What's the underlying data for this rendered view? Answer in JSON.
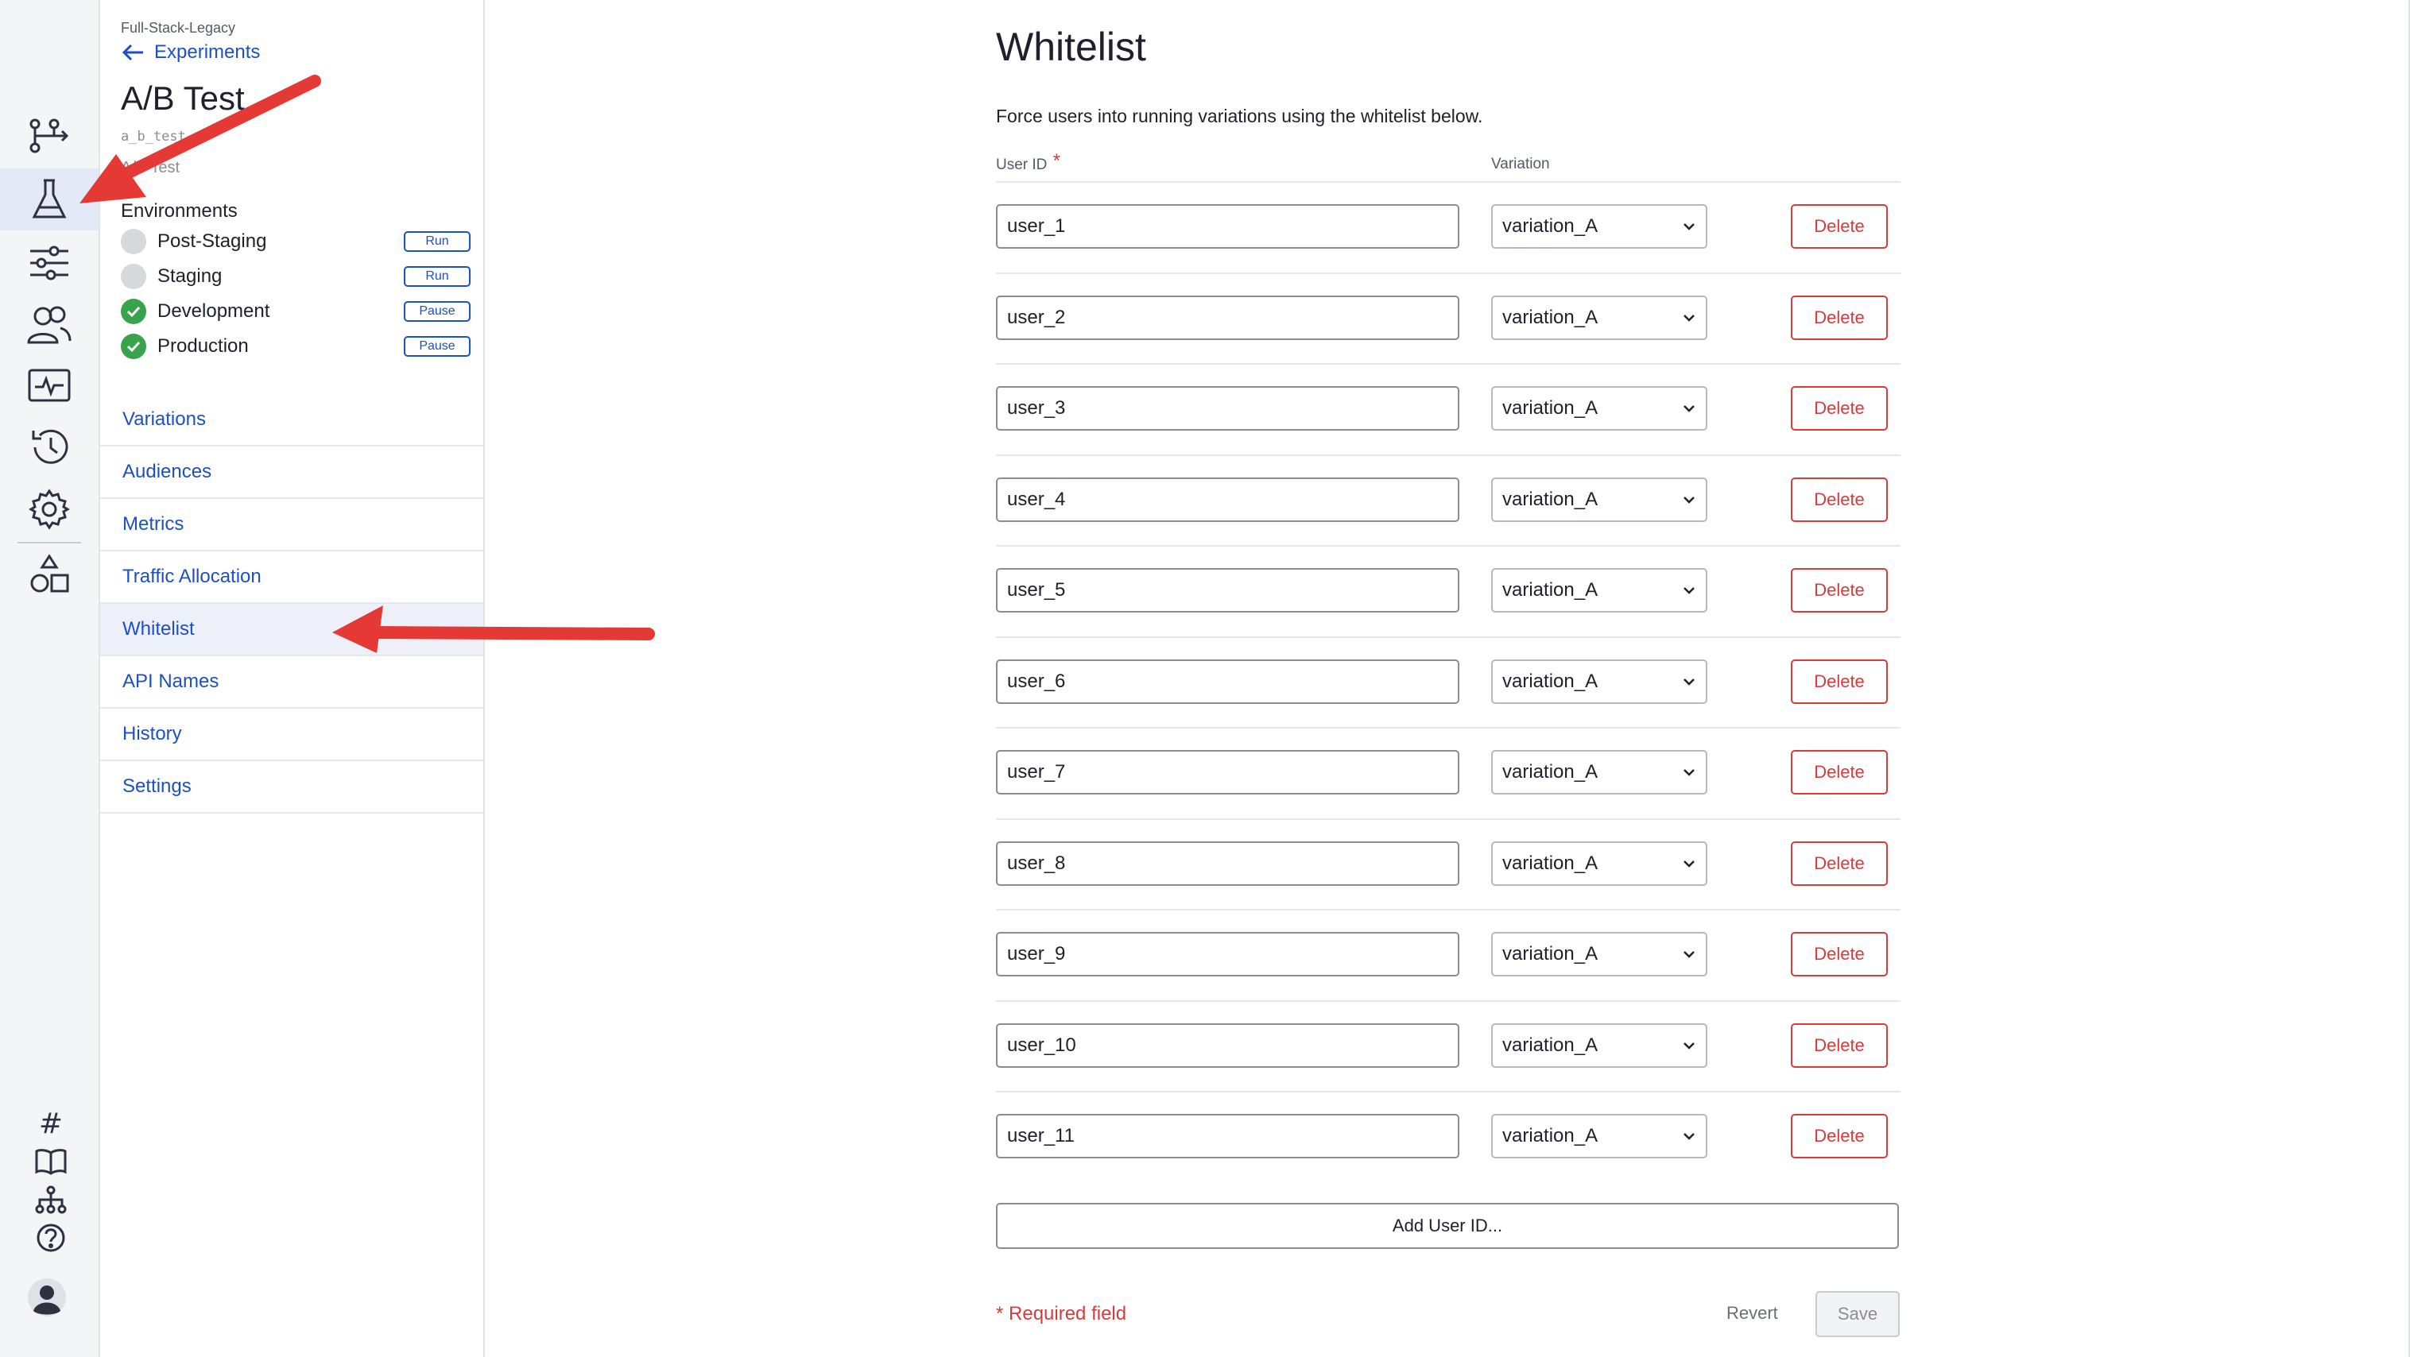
{
  "project": {
    "name": "Full-Stack-Legacy"
  },
  "back_link": {
    "label": "Experiments"
  },
  "experiment": {
    "title": "A/B Test",
    "key": "a_b_test",
    "type": "A/B Test"
  },
  "environments": {
    "title": "Environments",
    "items": [
      {
        "name": "Post-Staging",
        "status": "off",
        "action": "Run"
      },
      {
        "name": "Staging",
        "status": "off",
        "action": "Run"
      },
      {
        "name": "Development",
        "status": "on",
        "action": "Pause"
      },
      {
        "name": "Production",
        "status": "on",
        "action": "Pause"
      }
    ]
  },
  "nav": {
    "items": [
      {
        "label": "Variations",
        "active": false
      },
      {
        "label": "Audiences",
        "active": false
      },
      {
        "label": "Metrics",
        "active": false
      },
      {
        "label": "Traffic Allocation",
        "active": false
      },
      {
        "label": "Whitelist",
        "active": true
      },
      {
        "label": "API Names",
        "active": false
      },
      {
        "label": "History",
        "active": false
      },
      {
        "label": "Settings",
        "active": false
      }
    ]
  },
  "rail": {
    "icons": [
      "flag-branch-icon",
      "flask-icon",
      "sliders-icon",
      "users-icon",
      "monitor-icon",
      "history-icon",
      "gear-icon",
      "shapes-icon"
    ],
    "active_icon": "flask-icon",
    "bottom_icons": [
      "hash-icon",
      "book-icon",
      "hierarchy-icon",
      "help-icon",
      "avatar-icon"
    ],
    "hash_glyph": "#"
  },
  "main": {
    "title": "Whitelist",
    "description": "Force users into running variations using the whitelist below.",
    "col_user_id": "User ID",
    "required_mark": "*",
    "col_variation": "Variation",
    "delete_label": "Delete",
    "rows": [
      {
        "user_id": "user_1",
        "variation": "variation_A"
      },
      {
        "user_id": "user_2",
        "variation": "variation_A"
      },
      {
        "user_id": "user_3",
        "variation": "variation_A"
      },
      {
        "user_id": "user_4",
        "variation": "variation_A"
      },
      {
        "user_id": "user_5",
        "variation": "variation_A"
      },
      {
        "user_id": "user_6",
        "variation": "variation_A"
      },
      {
        "user_id": "user_7",
        "variation": "variation_A"
      },
      {
        "user_id": "user_8",
        "variation": "variation_A"
      },
      {
        "user_id": "user_9",
        "variation": "variation_A"
      },
      {
        "user_id": "user_10",
        "variation": "variation_A"
      },
      {
        "user_id": "user_11",
        "variation": "variation_A"
      }
    ],
    "add_label": "Add User ID...",
    "required_note": "* Required field",
    "revert_label": "Revert",
    "save_label": "Save"
  },
  "colors": {
    "accent": "#1c4fc8",
    "danger": "#d93a3a",
    "success": "#37a34a",
    "annotation_arrow": "#e53935"
  }
}
